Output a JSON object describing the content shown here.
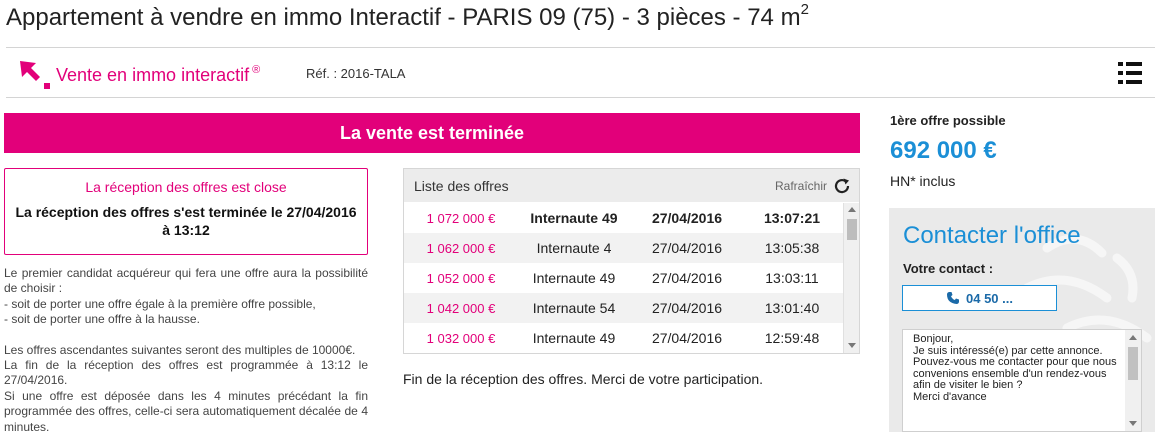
{
  "page": {
    "title_main": "Appartement à vendre en immo Interactif - PARIS 09 (75) - 3 pièces - 74 m",
    "title_sup": "2"
  },
  "header": {
    "brand_name": "Vente en immo interactif",
    "brand_mark": "®",
    "reference": "Réf. : 2016-TALA",
    "menu_icon": "list-menu-icon"
  },
  "banner": {
    "text": "La vente est terminée"
  },
  "status_box": {
    "heading": "La réception des offres est close",
    "message": "La réception des offres s'est terminée le 27/04/2016 à 13:12"
  },
  "rules": {
    "p1": "Le premier candidat acquéreur qui fera une offre aura la possibilité de choisir :",
    "p2": "- soit de porter une offre égale à la première offre possible,",
    "p3": "- soit de porter une offre à la hausse.",
    "p4": "Les offres ascendantes suivantes seront des multiples de 10000€.",
    "p5": "La fin de la réception des offres est programmée à 13:12 le 27/04/2016.",
    "p6": "Si une offre est déposée dans les 4 minutes précédant la fin programmée des offres, celle-ci sera automatiquement décalée de 4 minutes."
  },
  "offers": {
    "title": "Liste des offres",
    "refresh_label": "Rafraîchir",
    "rows": [
      {
        "amount": "1 072 000 €",
        "bidder": "Internaute 49",
        "date": "27/04/2016",
        "time": "13:07:21"
      },
      {
        "amount": "1 062 000 €",
        "bidder": "Internaute 4",
        "date": "27/04/2016",
        "time": "13:05:38"
      },
      {
        "amount": "1 052 000 €",
        "bidder": "Internaute 49",
        "date": "27/04/2016",
        "time": "13:03:11"
      },
      {
        "amount": "1 042 000 €",
        "bidder": "Internaute 54",
        "date": "27/04/2016",
        "time": "13:01:40"
      },
      {
        "amount": "1 032 000 €",
        "bidder": "Internaute 49",
        "date": "27/04/2016",
        "time": "12:59:48"
      }
    ],
    "end_message": "Fin de la réception des offres. Merci de votre participation."
  },
  "sidebar": {
    "first_offer_label": "1ère offre possible",
    "first_offer_price": "692 000 €",
    "fees_note": "HN* inclus"
  },
  "contact": {
    "title": "Contacter l'office",
    "subtitle": "Votre contact :",
    "phone": "04 50 ...",
    "message": "Bonjour,\nJe suis intéressé(e) par cette annonce. Pouvez-vous me contacter pour que nous convenions ensemble d'un rendez-vous afin de visiter le bien ?\nMerci d'avance"
  },
  "colors": {
    "accent": "#e2007a",
    "blue": "#1b8fd6"
  }
}
